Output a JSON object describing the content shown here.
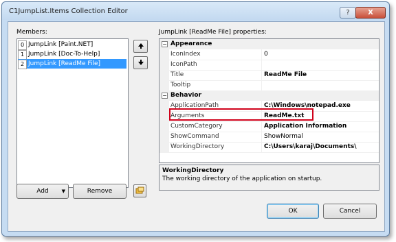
{
  "window": {
    "title": "C1JumpList.Items Collection Editor",
    "help_label": "?",
    "close_label": "X"
  },
  "members": {
    "label": "Members:",
    "items": [
      {
        "index": "0",
        "text": "JumpLink [Paint.NET]"
      },
      {
        "index": "1",
        "text": "JumpLink [Doc-To-Help]"
      },
      {
        "index": "2",
        "text": "JumpLink [ReadMe File]"
      }
    ],
    "selected_index": 2
  },
  "buttons": {
    "add": "Add",
    "remove": "Remove",
    "ok": "OK",
    "cancel": "Cancel"
  },
  "properties": {
    "label": "JumpLink [ReadMe File] properties:",
    "appearance_label": "Appearance",
    "behavior_label": "Behavior",
    "appearance": [
      {
        "name": "IconIndex",
        "value": "0",
        "bold": false
      },
      {
        "name": "IconPath",
        "value": "",
        "bold": false
      },
      {
        "name": "Title",
        "value": "ReadMe File",
        "bold": true
      },
      {
        "name": "Tooltip",
        "value": "",
        "bold": false
      }
    ],
    "behavior": [
      {
        "name": "ApplicationPath",
        "value": "C:\\Windows\\notepad.exe",
        "bold": true
      },
      {
        "name": "Arguments",
        "value": "ReadMe.txt",
        "bold": true
      },
      {
        "name": "CustomCategory",
        "value": "Application Information",
        "bold": true
      },
      {
        "name": "ShowCommand",
        "value": "ShowNormal",
        "bold": false
      },
      {
        "name": "WorkingDirectory",
        "value": "C:\\Users\\karaj\\Documents\\",
        "bold": true
      }
    ]
  },
  "description": {
    "title": "WorkingDirectory",
    "text": "The working directory of the application on startup."
  },
  "colors": {
    "selection": "#3399ff",
    "highlight_box": "#d0021b"
  }
}
